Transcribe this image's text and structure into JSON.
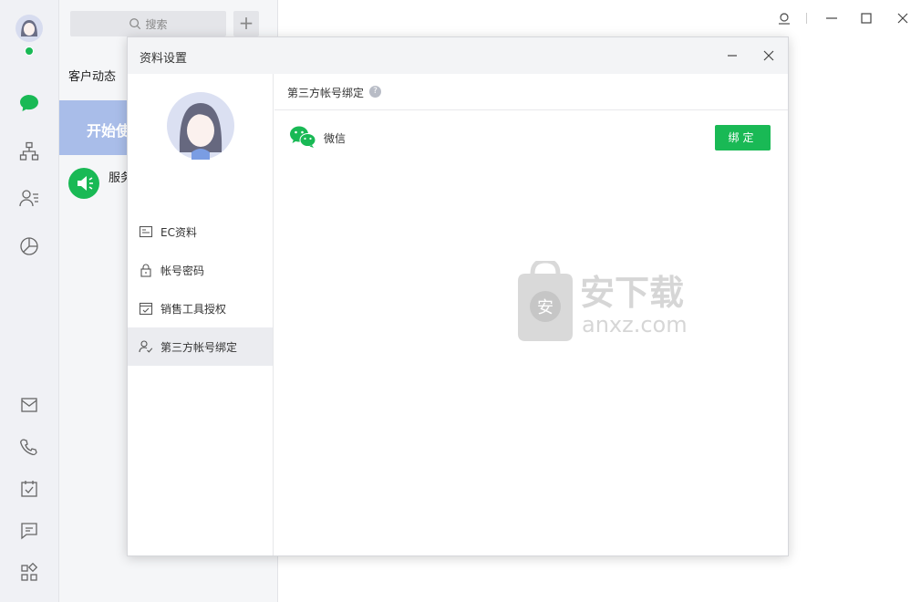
{
  "colors": {
    "accent_green": "#19b955",
    "rail_bg": "#f0f1f5",
    "panel_bg": "#f5f6f8",
    "banner_bg": "#a9bde9"
  },
  "rail": {
    "icons": [
      "chat-icon",
      "org-icon",
      "contacts-icon",
      "stats-icon",
      "mail-icon",
      "phone-icon",
      "task-icon",
      "message-icon",
      "apps-icon"
    ]
  },
  "midpanel": {
    "search_placeholder": "搜索",
    "add_label": "+",
    "feed_title": "客户动态",
    "banner_text": "开始使",
    "service_label": "服务"
  },
  "dialog": {
    "title": "资料设置",
    "menu": [
      {
        "label": "EC资料",
        "icon": "card-icon"
      },
      {
        "label": "帐号密码",
        "icon": "lock-icon"
      },
      {
        "label": "销售工具授权",
        "icon": "check-calendar-icon"
      },
      {
        "label": "第三方帐号绑定",
        "icon": "user-check-icon",
        "active": true
      }
    ],
    "section_title": "第三方帐号绑定",
    "help_glyph": "?",
    "wechat_label": "微信",
    "bind_label": "绑定"
  },
  "watermark": {
    "logo_char": "安",
    "text_cn": "安下载",
    "text_en": "anxz.com"
  }
}
